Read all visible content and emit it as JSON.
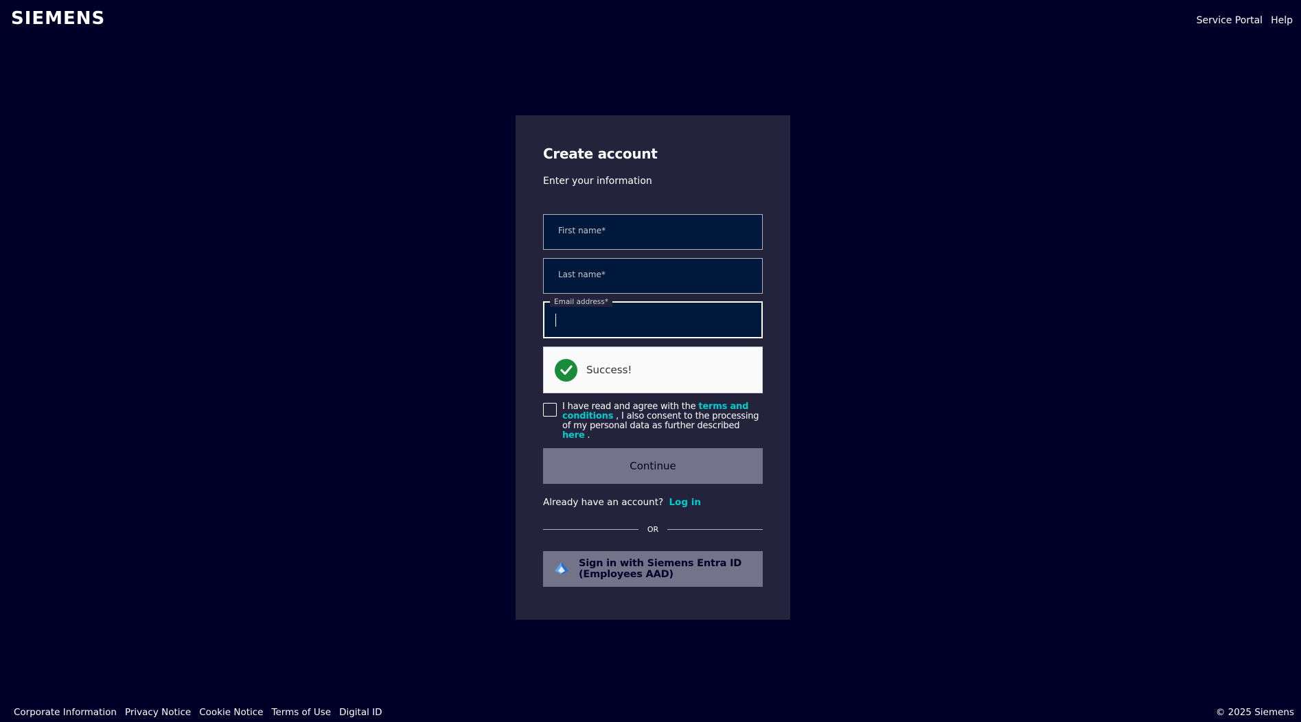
{
  "header": {
    "logo": "SIEMENS",
    "nav": [
      "Service Portal",
      "Help"
    ]
  },
  "card": {
    "title": "Create account",
    "subtitle": "Enter your information",
    "fields": {
      "first_name": {
        "placeholder": "First name*",
        "value": ""
      },
      "last_name": {
        "placeholder": "Last name*",
        "value": ""
      },
      "email": {
        "label": "Email address*",
        "value": ""
      }
    },
    "captcha": {
      "status": "Success!",
      "icon": "check-circle-icon",
      "color": "#1a8b3a"
    },
    "terms": {
      "checked": false,
      "text_before": "I have read and agree with the ",
      "link1": "terms and conditions",
      "text_middle": " , I also consent to the processing of my personal data as further described ",
      "link2": "here",
      "text_after": " ."
    },
    "continue_label": "Continue",
    "already_text": "Already have an account?",
    "login_label": "Log in",
    "divider_text": "OR",
    "entra_label": "Sign in with Siemens Entra ID (Employees AAD)",
    "entra_icon": "entra-id-icon"
  },
  "footer": {
    "links": [
      "Corporate Information",
      "Privacy Notice",
      "Cookie Notice",
      "Terms of Use",
      "Digital ID"
    ],
    "copyright": "© 2025 Siemens"
  },
  "colors": {
    "background": "#000028",
    "card": "#23233c",
    "accent": "#00cccc",
    "button": "#737389"
  }
}
